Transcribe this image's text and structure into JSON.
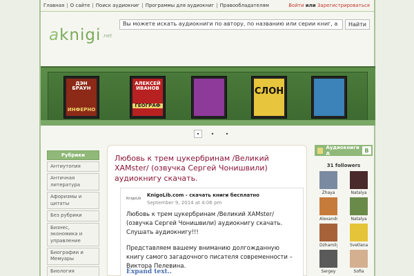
{
  "topnav": {
    "links": [
      "Главная",
      "О сайте",
      "Поиск аудиокниг",
      "Программы для аудиокниг",
      "Правообладателям"
    ],
    "login": "Войти",
    "or": "или",
    "register": "Зарегистрироваться"
  },
  "logo": {
    "main": "knigi",
    "prefix": "a",
    "suffix": ".net"
  },
  "search": {
    "placeholder": "Вы можете искать аудиокниги по автору, по названию или серии книг, а",
    "button": "Найти"
  },
  "shelf": {
    "books": [
      {
        "title": "ДЭН БРАУН",
        "subtitle": "ИНФЕРНО",
        "color": "#8c2a17"
      },
      {
        "title": "АЛЕКСЕЙ ИВАНОВ",
        "subtitle": "ГЕОГРАФ",
        "color": "#b82121"
      },
      {
        "title": "",
        "subtitle": "",
        "color": "#8e3a9a"
      },
      {
        "title": "СЛОН",
        "subtitle": "",
        "color": "#e7c53d"
      },
      {
        "title": "",
        "subtitle": "",
        "color": "#3b83b8"
      }
    ]
  },
  "pager": {
    "dots": [
      "•",
      "•",
      "•"
    ]
  },
  "sidebar": {
    "header": "Рубрики",
    "items": [
      "Антиутопия",
      "Античная литература",
      "Афоризмы и цитаты",
      "Без рубрики",
      "Бизнес, экономика и управление",
      "Биографии и Мемуары",
      "Биология"
    ]
  },
  "post": {
    "title": "Любовь к трем цукербринам /Великий XAMster/ (озвучка Сергей Чонишвили) аудиокнигу скачать.",
    "card": {
      "logo": "KnigoLib",
      "site": "KnigoLib.com - скачать книги бесплатно",
      "date": "September 9, 2014 at 4:06 pm",
      "body1": "Любовь к трем цукербринам /Великий XAMster/ (озвучка Сергей Чонишвили) аудиокнигу скачать. Слушать аудиокнигу!!!",
      "body2": "Представляем вашему вниманию долгожданную книгу самого загадочного писателя современности – Виктора Пелевина.",
      "more": "Expand text.."
    }
  },
  "followers": {
    "header": "Аудиокниги д",
    "badge": "B",
    "count": "31 followers",
    "people": [
      {
        "name": "Zhaya",
        "color": "#7a8aa0"
      },
      {
        "name": "Natalya",
        "color": "#4a2a2a"
      },
      {
        "name": "Alexandra",
        "color": "#c77b3b"
      },
      {
        "name": "Natalya",
        "color": "#6a8a4a"
      },
      {
        "name": "Dzhamilya",
        "color": "#a7623a"
      },
      {
        "name": "Svetlana",
        "color": "#e6c43a"
      },
      {
        "name": "Sergey",
        "color": "#5a5a5a"
      },
      {
        "name": "Sofia",
        "color": "#d4b090"
      }
    ]
  }
}
